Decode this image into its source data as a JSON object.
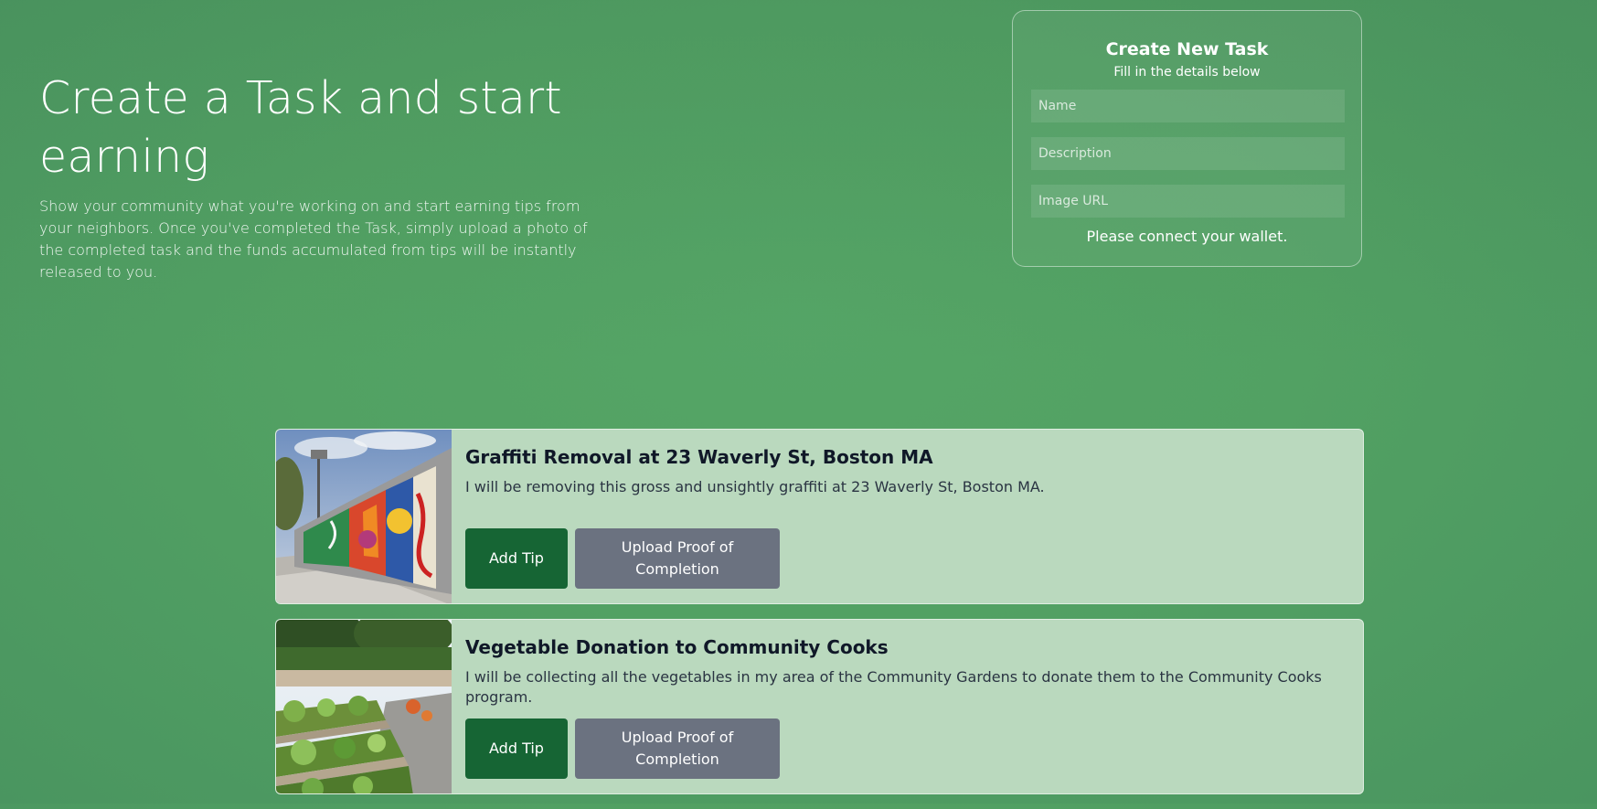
{
  "hero": {
    "title": "Create a Task and start earning",
    "subtitle": "Show your community what you're working on and start earning tips from your neighbors. Once you've completed the Task, simply upload a photo of the completed task and the funds accumulated from tips will be instantly released to you."
  },
  "create_form": {
    "title": "Create New Task",
    "subtitle": "Fill in the details below",
    "name_placeholder": "Name",
    "description_placeholder": "Description",
    "image_url_placeholder": "Image URL",
    "wallet_message": "Please connect your wallet."
  },
  "tasks": [
    {
      "title": "Graffiti Removal at 23 Waverly St, Boston MA",
      "description": "I will be removing this gross and unsightly graffiti at 23 Waverly St, Boston MA.",
      "tip_label": "Add Tip",
      "upload_label": "Upload Proof of Completion",
      "image": "graffiti-wall-photo"
    },
    {
      "title": "Vegetable Donation to Community Cooks",
      "description": "I will be collecting all the vegetables in my area of the Community Gardens to donate them to the Community Cooks program.",
      "tip_label": "Add Tip",
      "upload_label": "Upload Proof of Completion",
      "image": "community-garden-photo"
    }
  ],
  "colors": {
    "background": "#52a163",
    "card": "#bad9be",
    "tip_button": "#166534",
    "upload_button": "#6b7280"
  }
}
